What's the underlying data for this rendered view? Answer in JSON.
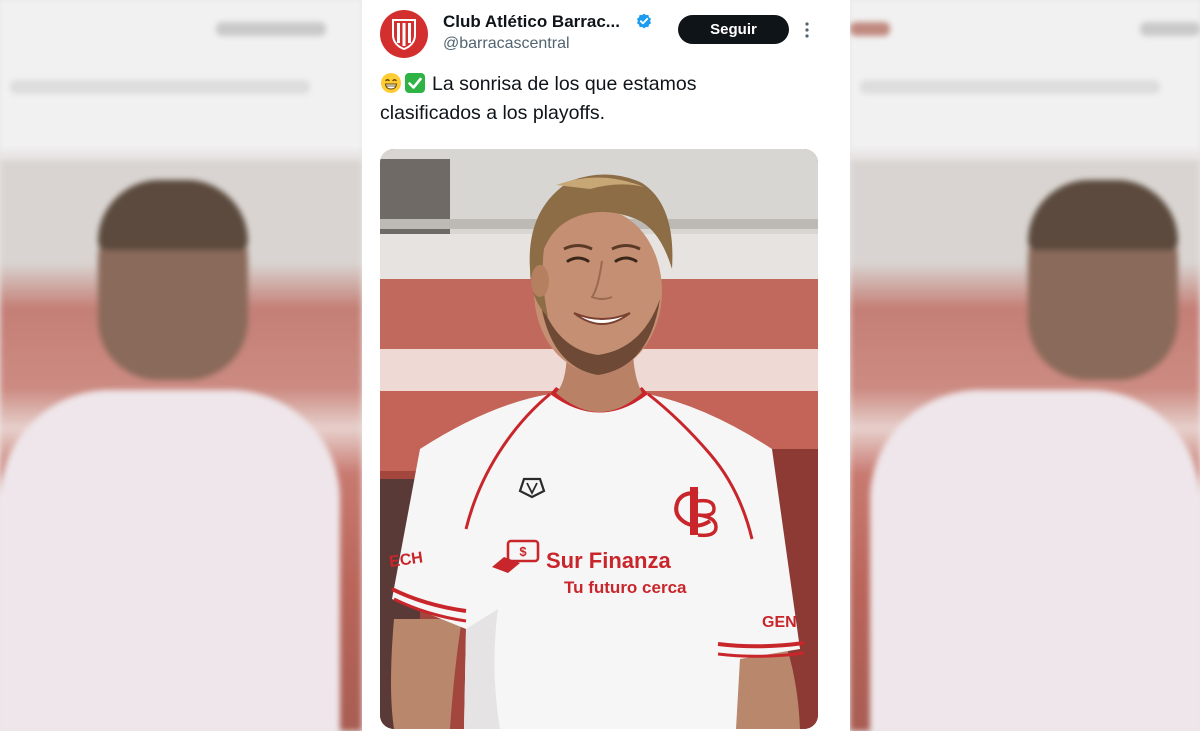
{
  "tweet": {
    "account_name": "Club Atlético Barrac...",
    "handle": "@barracascentral",
    "follow_label": "Seguir",
    "text_line1": "La sonrisa de los que estamos",
    "text_line2": "clasificados a los playoffs."
  },
  "media": {
    "sponsor_name": "Sur Finanza",
    "sponsor_tagline": "Tu futuro cerca",
    "sleeve_left": "ECH",
    "sleeve_right": "GEN",
    "crest_letters": "CB"
  },
  "icons": {
    "avatar": "club-crest-icon",
    "verified": "verified-badge-icon",
    "more": "more-options-icon",
    "emoji_1": "grinning-face-icon",
    "emoji_2": "check-mark-button-icon"
  },
  "colors": {
    "brand_red": "#d32f2f",
    "verified_blue": "#1d9bf0",
    "check_green": "#2fb344",
    "follow_button": "#0f1419"
  }
}
